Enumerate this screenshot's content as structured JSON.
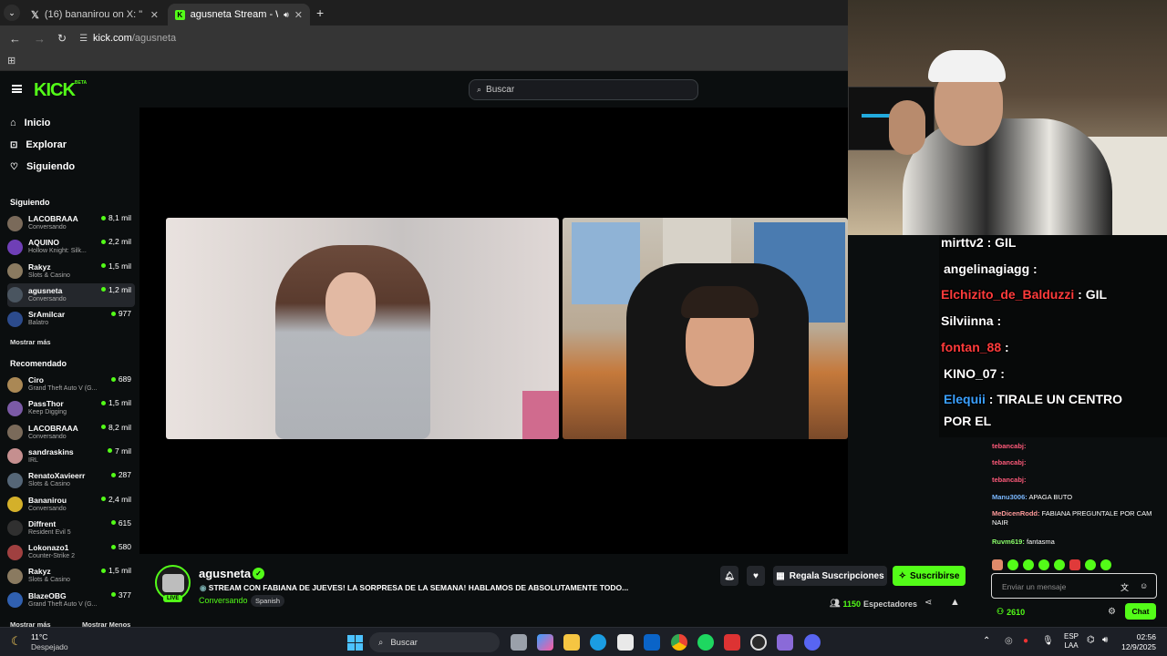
{
  "browser": {
    "tabs": [
      {
        "label": "(16) bananirou on X: \"DOMINGO",
        "active": false
      },
      {
        "label": "agusneta Stream - Watch L",
        "active": true
      }
    ],
    "url_host": "kick.com",
    "url_path": "/agusneta"
  },
  "header": {
    "logo": "KICK",
    "logo_badge": "BETA",
    "search_placeholder": "Buscar"
  },
  "sidebar": {
    "nav": [
      {
        "label": "Inicio",
        "icon": "home-icon"
      },
      {
        "label": "Explorar",
        "icon": "compass-icon"
      },
      {
        "label": "Siguiendo",
        "icon": "heart-icon"
      }
    ],
    "following_title": "Siguiendo",
    "following": [
      {
        "name": "LACOBRAAA",
        "category": "Conversando",
        "viewers": "8,1 mil",
        "color": "#7a6a5a"
      },
      {
        "name": "AQUINO",
        "category": "Hollow Knight: Silk...",
        "viewers": "2,2 mil",
        "color": "#6f3fb6"
      },
      {
        "name": "Rakyz",
        "category": "Slots & Casino",
        "viewers": "1,5 mil",
        "color": "#8a7a60"
      },
      {
        "name": "agusneta",
        "category": "Conversando",
        "viewers": "1,2 mil",
        "color": "#4a5560",
        "selected": true
      },
      {
        "name": "SrAmilcar",
        "category": "Balatro",
        "viewers": "977",
        "color": "#2c4b8c"
      }
    ],
    "following_more": "Mostrar más",
    "recommended_title": "Recomendado",
    "recommended": [
      {
        "name": "Ciro",
        "category": "Grand Theft Auto V (G...",
        "viewers": "689",
        "color": "#aa8855"
      },
      {
        "name": "PassThor",
        "category": "Keep Digging",
        "viewers": "1,5 mil",
        "color": "#7b5aa6"
      },
      {
        "name": "LACOBRAAA",
        "category": "Conversando",
        "viewers": "8,2 mil",
        "color": "#7a6a5a"
      },
      {
        "name": "sandraskins",
        "category": "IRL",
        "viewers": "7 mil",
        "color": "#c58f8f"
      },
      {
        "name": "RenatoXavieerr",
        "category": "Slots & Casino",
        "viewers": "287",
        "color": "#556677"
      },
      {
        "name": "Bananirou",
        "category": "Conversando",
        "viewers": "2,4 mil",
        "color": "#d4b02a"
      },
      {
        "name": "Diffrent",
        "category": "Resident Evil 5",
        "viewers": "615",
        "color": "#303030"
      },
      {
        "name": "Lokonazo1",
        "category": "Counter-Strike 2",
        "viewers": "580",
        "color": "#a04040"
      },
      {
        "name": "Rakyz",
        "category": "Slots & Casino",
        "viewers": "1,5 mil",
        "color": "#8a7a60"
      },
      {
        "name": "BlazeOBG",
        "category": "Grand Theft Auto V (G...",
        "viewers": "377",
        "color": "#3060b0"
      }
    ],
    "recommended_more": "Mostrar más",
    "recommended_less": "Mostrar Menos"
  },
  "stream": {
    "channel": "agusneta",
    "live_badge": "LIVE",
    "title": "STREAM CON FABIANA DE JUEVES! LA SORPRESA DE LA SEMANA! HABLAMOS DE ABSOLUTAMENTE TODO...",
    "category": "Conversando",
    "language": "Spanish",
    "gift_label": "Regala Suscripciones",
    "subscribe_label": "Suscribirse",
    "viewers_count": "1150",
    "viewers_label": "Espectadores"
  },
  "overlay_chat": [
    {
      "user": "mirttv2",
      "text": ": GIL",
      "color": "#ffffff"
    },
    {
      "user": "angelinagiagg",
      "text": ":",
      "color": "#ffffff"
    },
    {
      "user": "Elchizito_de_Balduzzi",
      "text": ": GIL",
      "color": "#ff3b3b"
    },
    {
      "user": "Silviinna",
      "text": ":",
      "color": "#ffffff"
    },
    {
      "user": "fontan_88",
      "text": ":",
      "color": "#ff3b3b"
    },
    {
      "user": "KINO_07",
      "text": ":",
      "color": "#ffffff"
    },
    {
      "user": "Elequii",
      "text": ": TIRALE UN CENTRO",
      "color": "#3aa0ff"
    },
    {
      "user": "",
      "text": "POR EL",
      "color": "#ffffff"
    }
  ],
  "chat": {
    "messages": [
      {
        "user": "tebancabj:",
        "text": "",
        "color": "#ff5a7a"
      },
      {
        "user": "tebancabj:",
        "text": "",
        "color": "#ff5a7a"
      },
      {
        "user": "tebancabj:",
        "text": "",
        "color": "#ff5a7a"
      },
      {
        "user": "Manu3006:",
        "text": "APAGA BUTO",
        "color": "#7ab8ff"
      },
      {
        "user": "MeDicenRodd:",
        "text": "FABIANA PREGUNTALE POR CAM NAIR",
        "color": "#ff9a9a"
      },
      {
        "user": "Ruvm619:",
        "text": "fantasma",
        "color": "#8aff6a"
      }
    ],
    "input_placeholder": "Enviar un mensaje",
    "points": "2610",
    "chat_button": "Chat"
  },
  "taskbar": {
    "weather_temp": "11°C",
    "weather_desc": "Despejado",
    "search": "Buscar",
    "lang_top": "ESP",
    "lang_bottom": "LAA",
    "time": "02:56",
    "date": "12/9/2025"
  }
}
